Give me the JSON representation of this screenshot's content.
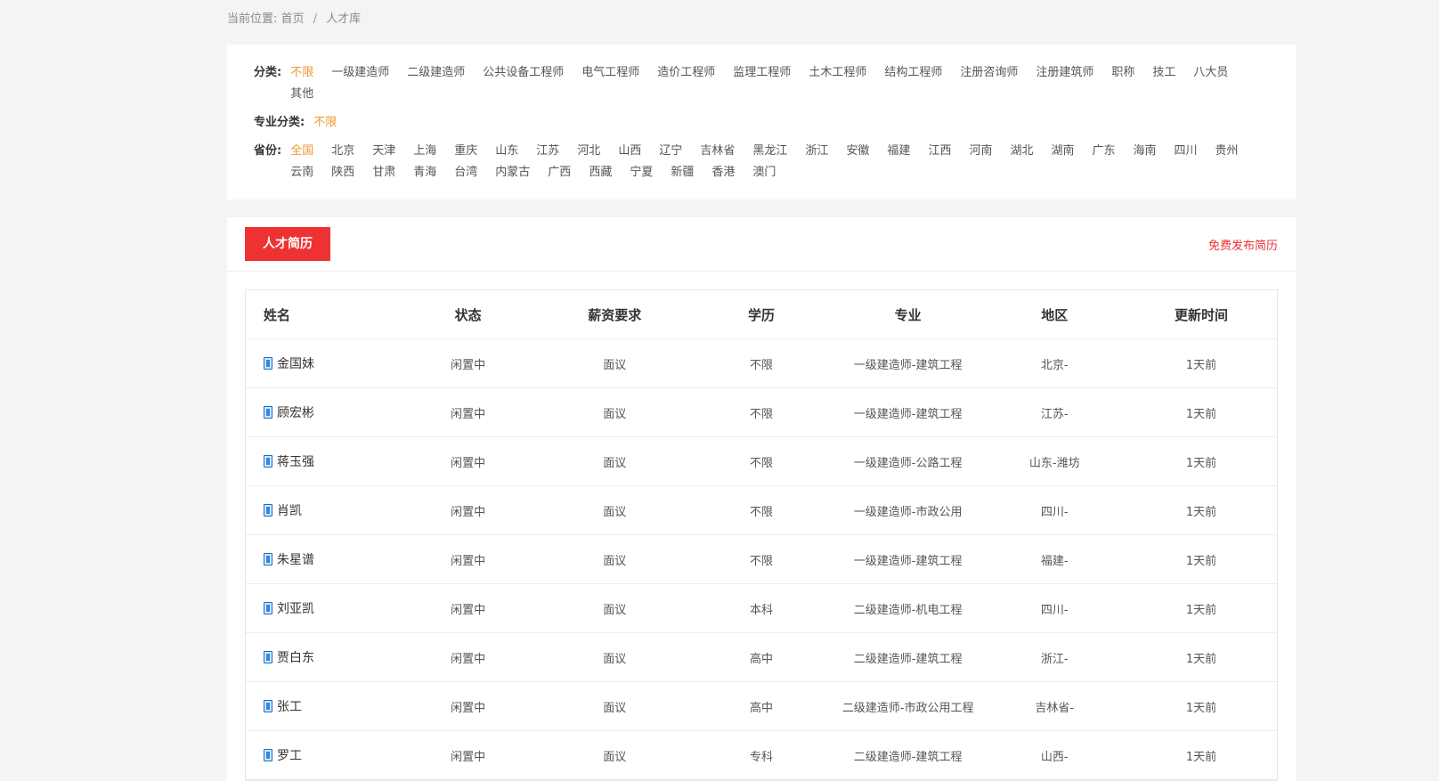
{
  "breadcrumb": {
    "prefix": "当前位置:",
    "home": "首页",
    "sep": "/",
    "current": "人才库"
  },
  "filters": {
    "category": {
      "label": "分类:",
      "items": [
        "不限",
        "一级建造师",
        "二级建造师",
        "公共设备工程师",
        "电气工程师",
        "造价工程师",
        "监理工程师",
        "土木工程师",
        "结构工程师",
        "注册咨询师",
        "注册建筑师",
        "职称",
        "技工",
        "八大员",
        "其他"
      ],
      "active": 0
    },
    "specialty": {
      "label": "专业分类:",
      "items": [
        "不限"
      ],
      "active": 0
    },
    "province": {
      "label": "省份:",
      "items": [
        "全国",
        "北京",
        "天津",
        "上海",
        "重庆",
        "山东",
        "江苏",
        "河北",
        "山西",
        "辽宁",
        "吉林省",
        "黑龙江",
        "浙江",
        "安徽",
        "福建",
        "江西",
        "河南",
        "湖北",
        "湖南",
        "广东",
        "海南",
        "四川",
        "贵州",
        "云南",
        "陕西",
        "甘肃",
        "青海",
        "台湾",
        "内蒙古",
        "广西",
        "西藏",
        "宁夏",
        "新疆",
        "香港",
        "澳门"
      ],
      "active": 0
    }
  },
  "panel": {
    "tab_label": "人才简历",
    "publish_link": "免费发布简历"
  },
  "table": {
    "headers": [
      "姓名",
      "状态",
      "薪资要求",
      "学历",
      "专业",
      "地区",
      "更新时间"
    ],
    "rows": [
      [
        "金国妹",
        "闲置中",
        "面议",
        "不限",
        "一级建造师-建筑工程",
        "北京-",
        "1天前"
      ],
      [
        "顾宏彬",
        "闲置中",
        "面议",
        "不限",
        "一级建造师-建筑工程",
        "江苏-",
        "1天前"
      ],
      [
        "蒋玉强",
        "闲置中",
        "面议",
        "不限",
        "一级建造师-公路工程",
        "山东-潍坊",
        "1天前"
      ],
      [
        "肖凯",
        "闲置中",
        "面议",
        "不限",
        "一级建造师-市政公用",
        "四川-",
        "1天前"
      ],
      [
        "朱星谱",
        "闲置中",
        "面议",
        "不限",
        "一级建造师-建筑工程",
        "福建-",
        "1天前"
      ],
      [
        "刘亚凯",
        "闲置中",
        "面议",
        "本科",
        "二级建造师-机电工程",
        "四川-",
        "1天前"
      ],
      [
        "贾白东",
        "闲置中",
        "面议",
        "高中",
        "二级建造师-建筑工程",
        "浙江-",
        "1天前"
      ],
      [
        "张工",
        "闲置中",
        "面议",
        "高中",
        "二级建造师-市政公用工程",
        "吉林省-",
        "1天前"
      ],
      [
        "罗工",
        "闲置中",
        "面议",
        "专科",
        "二级建造师-建筑工程",
        "山西-",
        "1天前"
      ]
    ]
  },
  "colors": {
    "accent_orange": "#f0962e",
    "accent_red": "#ee3232",
    "icon_blue": "#2a8ae6"
  },
  "icons": {
    "row_icon": "document-icon"
  }
}
